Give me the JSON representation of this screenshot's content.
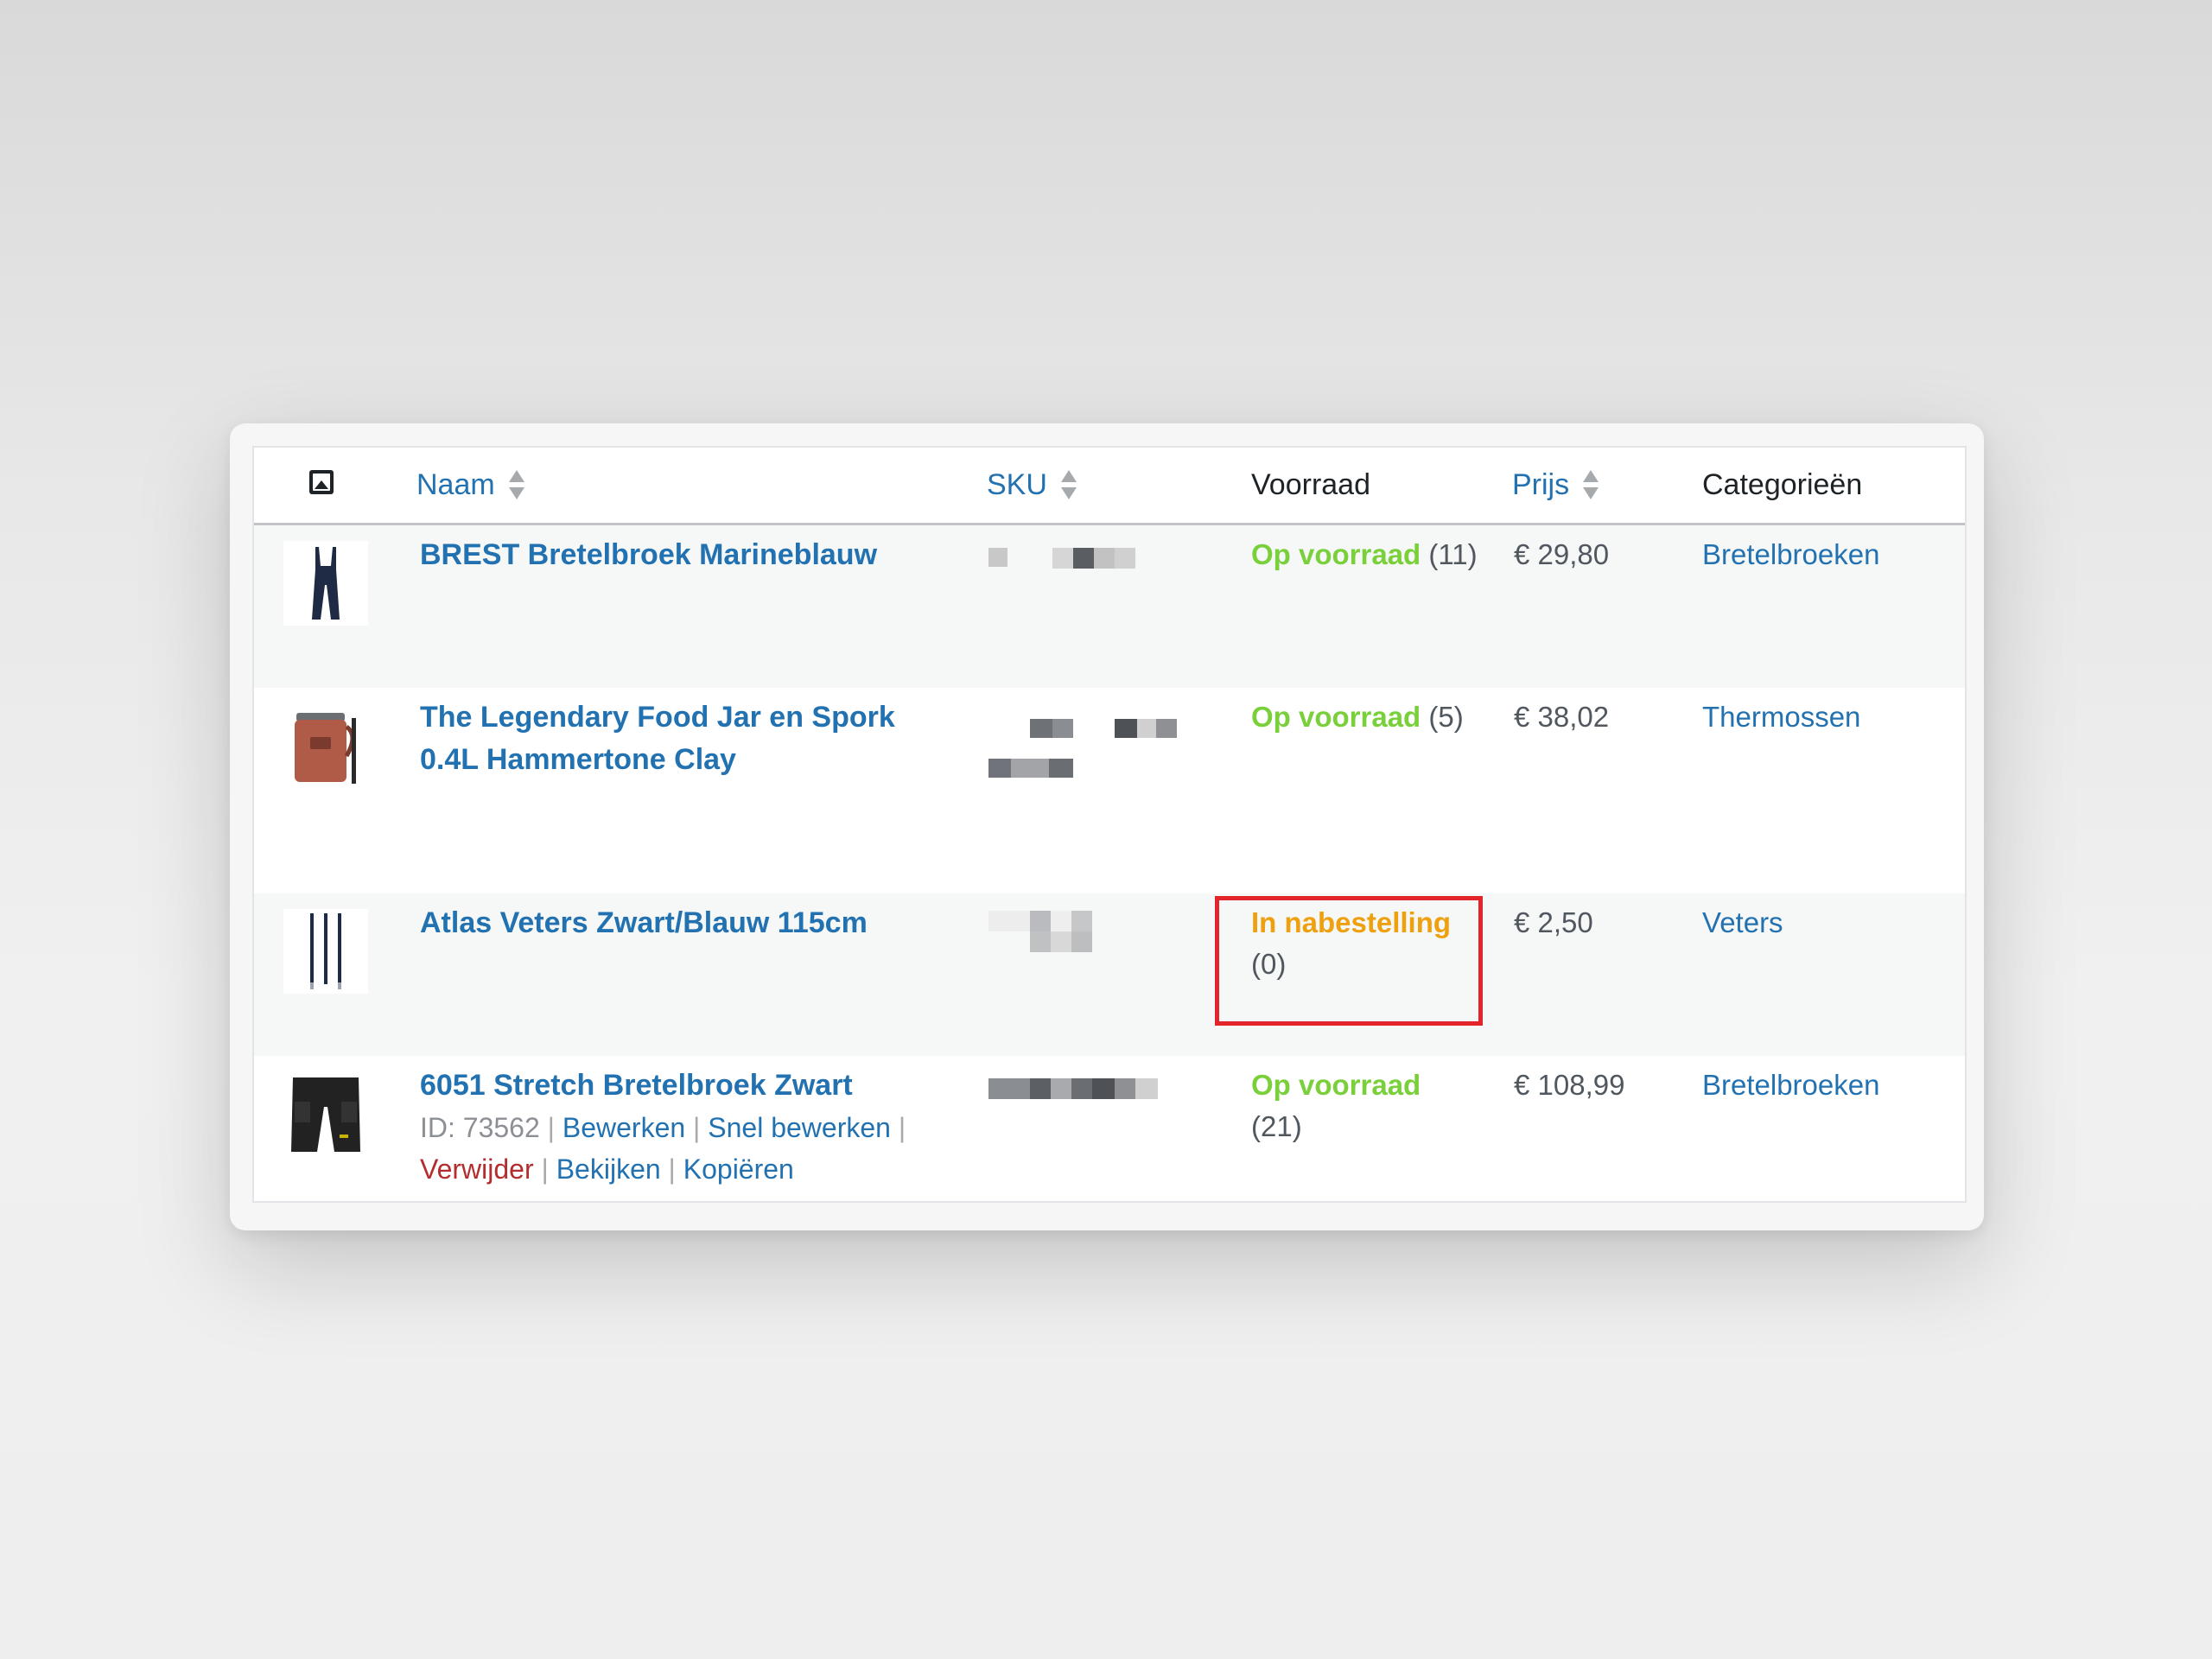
{
  "table": {
    "columns": {
      "image_icon": "image-icon",
      "name": "Naam",
      "sku": "SKU",
      "stock": "Voorraad",
      "price": "Prijs",
      "categories": "Categorieën"
    },
    "rows": [
      {
        "name": "BREST Bretelbroek Marineblauw",
        "stock_status": "Op voorraad",
        "stock_qty": "(11)",
        "price": "€ 29,80",
        "category": "Bretelbroeken",
        "thumb_icon": "overalls-icon"
      },
      {
        "name_line1": "The Legendary Food Jar en Spork",
        "name_line2": "0.4L Hammertone Clay",
        "stock_status": "Op voorraad",
        "stock_qty": "(5)",
        "price": "€ 38,02",
        "category": "Thermossen",
        "thumb_icon": "food-jar-icon"
      },
      {
        "name": "Atlas Veters Zwart/Blauw 115cm",
        "stock_status": "In nabestelling",
        "stock_qty": "(0)",
        "price": "€ 2,50",
        "category": "Veters",
        "thumb_icon": "laces-icon"
      },
      {
        "name": "6051 Stretch Bretelbroek Zwart",
        "id_text": "ID: 73562",
        "sep": "|",
        "actions": {
          "edit": "Bewerken",
          "quick_edit": "Snel bewerken",
          "delete": "Verwijder",
          "view": "Bekijken",
          "copy": "Kopiëren"
        },
        "stock_status": "Op voorraad",
        "stock_qty": "(21)",
        "price": "€ 108,99",
        "category": "Bretelbroeken",
        "thumb_icon": "work-pants-icon"
      }
    ]
  },
  "colors": {
    "link": "#2271b1",
    "in_stock": "#7ad03a",
    "backorder": "#eea00e",
    "danger": "#b32d2e",
    "highlight": "#e3242b"
  }
}
